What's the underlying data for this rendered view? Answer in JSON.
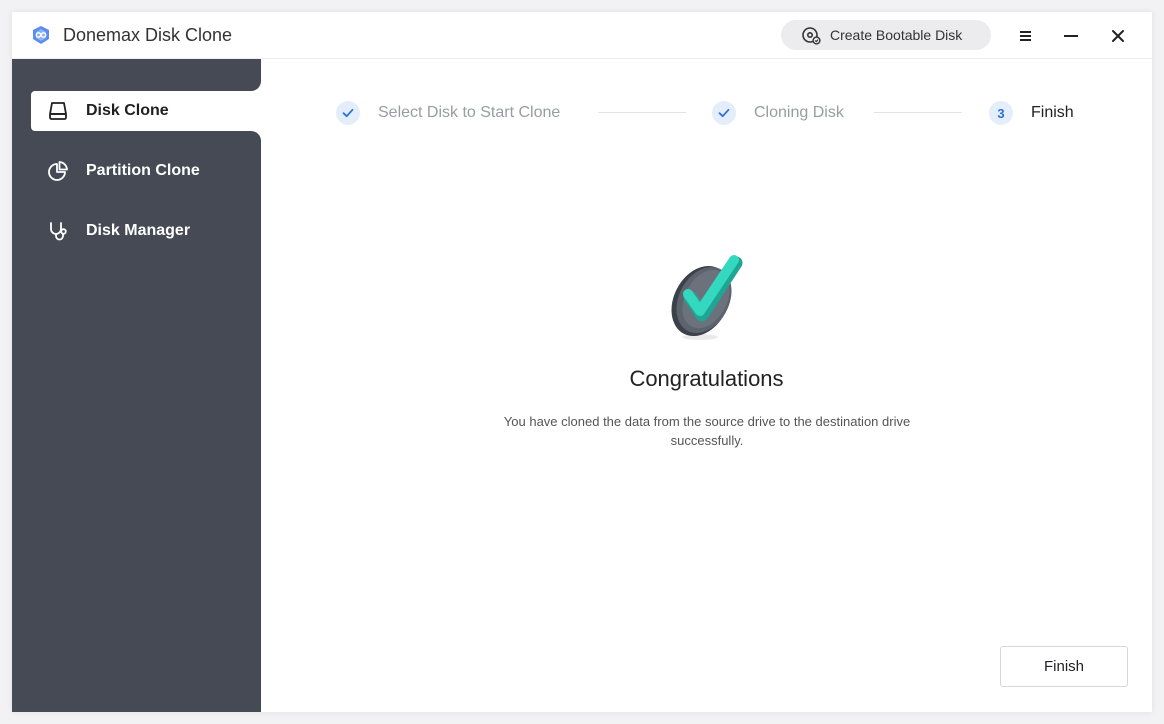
{
  "app": {
    "title": "Donemax Disk Clone",
    "logo_icon": "donemax-logo-icon",
    "accent_color": "#2f6fd8"
  },
  "titlebar": {
    "bootable_label": "Create Bootable Disk",
    "bootable_icon": "bootable-disk-icon",
    "menu_icon": "hamburger-menu-icon",
    "minimize_icon": "minimize-icon",
    "close_icon": "close-icon"
  },
  "sidebar": {
    "background": "#454a55",
    "items": [
      {
        "label": "Disk Clone",
        "icon": "hard-drive-icon",
        "active": true
      },
      {
        "label": "Partition Clone",
        "icon": "pie-chart-icon",
        "active": false
      },
      {
        "label": "Disk Manager",
        "icon": "stethoscope-icon",
        "active": false
      }
    ]
  },
  "steps": [
    {
      "label": "Select Disk to Start Clone",
      "status": "done"
    },
    {
      "label": "Cloning Disk",
      "status": "done"
    },
    {
      "number": "3",
      "label": "Finish",
      "status": "current"
    }
  ],
  "main": {
    "illustration_icon": "success-check-icon",
    "heading": "Congratulations",
    "message": "You have cloned the data from the source drive to the destination drive successfully.",
    "finish_label": "Finish"
  }
}
